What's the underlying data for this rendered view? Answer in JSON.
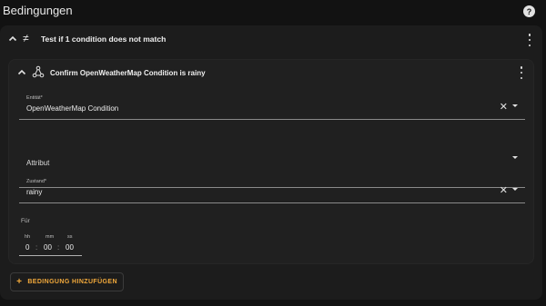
{
  "page": {
    "title": "Bedingungen"
  },
  "outer": {
    "title": "Test if 1 condition does not match"
  },
  "inner": {
    "title": "Confirm OpenWeatherMap Condition is rainy",
    "entity": {
      "label": "Entität*",
      "value": "OpenWeatherMap Condition"
    },
    "attribute": {
      "placeholder": "Attribut"
    },
    "state": {
      "label": "Zustand*",
      "value": "rainy"
    },
    "for": {
      "label": "Für",
      "hh_label": "hh",
      "mm_label": "mm",
      "ss_label": "ss",
      "hh": "0",
      "mm": "00",
      "ss": "00"
    }
  },
  "add_button": {
    "label": "BEDINGUNG HINZUFÜGEN"
  },
  "colors": {
    "accent": "#f2a93b",
    "card": "#1c1c1c",
    "inner_card": "#202020",
    "background": "#121212"
  },
  "icons": [
    "help-icon",
    "chevron-up-icon",
    "not-equal-icon",
    "kebab-menu-icon",
    "node-graph-icon",
    "close-icon",
    "dropdown-arrow-icon",
    "plus-icon"
  ]
}
